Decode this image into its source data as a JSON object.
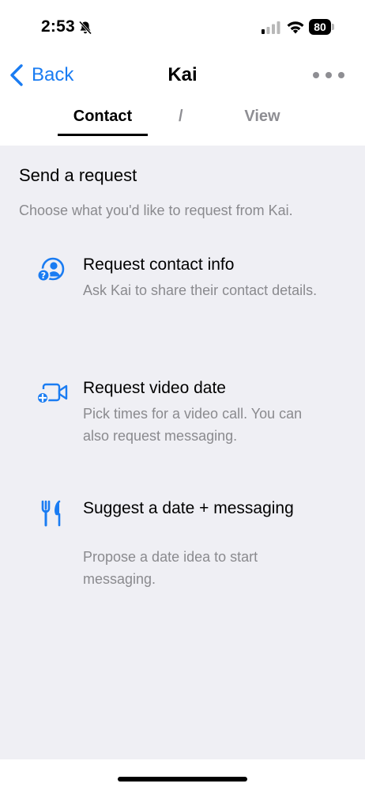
{
  "status_bar": {
    "time": "2:53",
    "battery": "80",
    "icons": [
      "bell-slash-icon",
      "cellular-signal-icon",
      "wifi-icon",
      "battery-icon"
    ]
  },
  "nav": {
    "back_label": "Back",
    "title": "Kai",
    "more_icon": "ellipsis-icon"
  },
  "tabs": {
    "contact": "Contact",
    "separator": "/",
    "view": "View"
  },
  "request": {
    "title": "Send a request",
    "subtitle": "Choose what you'd like to request from Kai.",
    "options": [
      {
        "icon": "contact-info-icon",
        "title": "Request contact info",
        "description": "Ask Kai to share their contact details."
      },
      {
        "icon": "video-add-icon",
        "title": "Request video date",
        "description": "Pick times for a video call. You can also request messaging."
      },
      {
        "icon": "fork-knife-icon",
        "title": "Suggest a date + messaging",
        "description": "Propose a date idea to start messaging."
      }
    ]
  },
  "colors": {
    "accent": "#1a7cf2",
    "content_background": "#efeff4",
    "secondary_text": "#8a8a8e"
  }
}
